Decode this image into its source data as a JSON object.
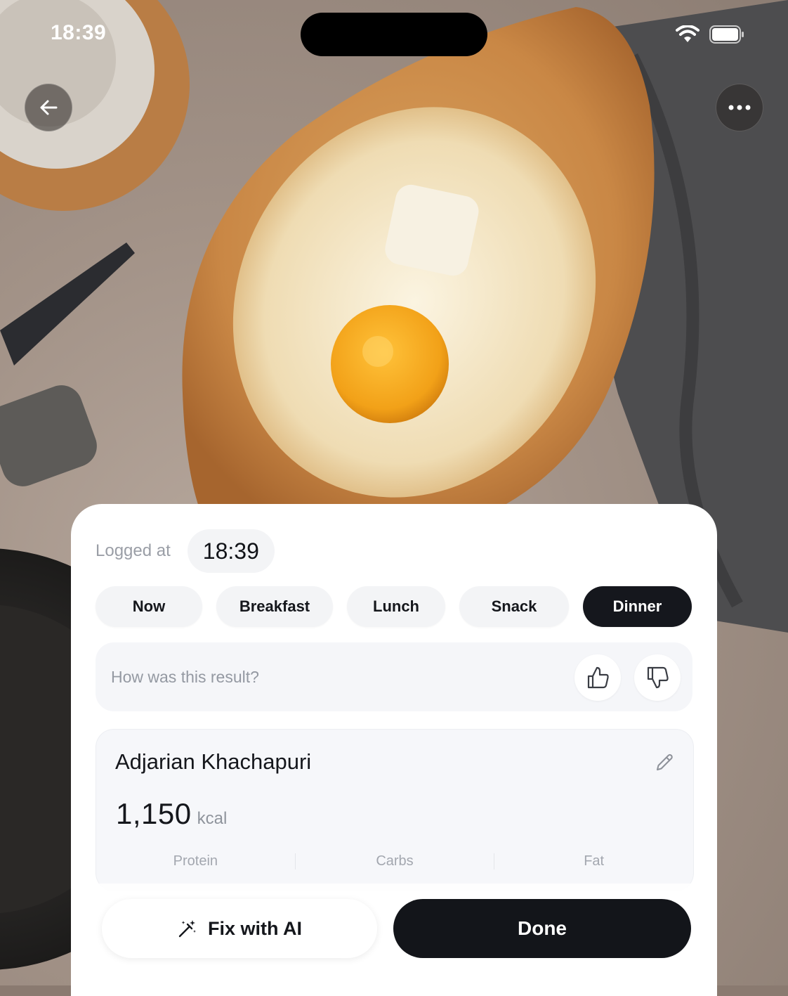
{
  "status_bar": {
    "time": "18:39"
  },
  "header": {
    "back_icon": "arrow-left-icon",
    "more_icon": "ellipsis-icon"
  },
  "logged": {
    "label": "Logged at",
    "time": "18:39"
  },
  "meal_types": {
    "items": [
      "Now",
      "Breakfast",
      "Lunch",
      "Snack",
      "Dinner"
    ],
    "selected": "Dinner"
  },
  "feedback": {
    "prompt": "How was this result?"
  },
  "food": {
    "name": "Adjarian Khachapuri",
    "calories": "1,150",
    "calories_unit": "kcal",
    "macros": [
      "Protein",
      "Carbs",
      "Fat"
    ]
  },
  "actions": {
    "fix_label": "Fix with AI",
    "done_label": "Done"
  },
  "colors": {
    "accent_dark": "#13151a",
    "chip_bg": "#f3f4f6",
    "sheet_bg": "#ffffff"
  }
}
